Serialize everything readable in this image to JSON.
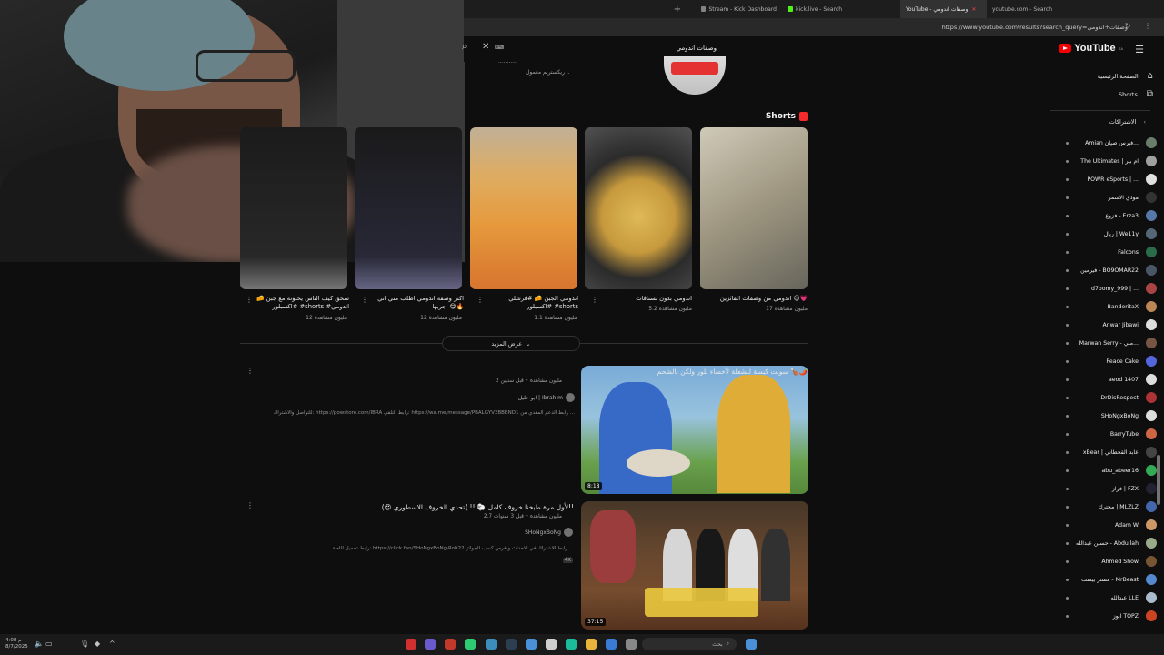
{
  "browser": {
    "tabs": [
      {
        "label": "Stream - Kick Dashboard",
        "color": "#888888",
        "active": false
      },
      {
        "label": "kick.live - Search",
        "color": "#53fc18",
        "active": false
      },
      {
        "label": "YouTube - وصفات اندومي",
        "color": "#ff0000",
        "active": true
      },
      {
        "label": "youtube.com - Search",
        "color": "#888888",
        "active": false
      }
    ],
    "url": "https://www.youtube.com/results?search_query=وصفات+اندومي",
    "add_tab": "+"
  },
  "youtube": {
    "logo_text": "YouTube",
    "logo_sup": "SA",
    "search_value": "وصفات اندومي",
    "top_lines": [
      "...........",
      "ريكستريم معمول .."
    ]
  },
  "shorts": {
    "heading": "Shorts",
    "items": [
      {
        "title": "اندومي من وصفات الفائزين 😍💗",
        "views": "17 مليون مشاهدة"
      },
      {
        "title": "اندومي بدون تستافات",
        "views": "5.2 مليون مشاهدة"
      },
      {
        "title": "اندومي الجبن 🧀 #فرشلي #اكسبلور #shorts",
        "views": "1.1 مليون مشاهدة"
      },
      {
        "title": "اكثر وصفة اندومي اطلب مني اني اجربها 😋🔥",
        "views": "12 مليون مشاهدة"
      },
      {
        "title": "سحق كيف الناس يحبونه مع جبن 🧀 #اكسبلور #shorts #اندومي",
        "views": "12 مليون مشاهدة"
      }
    ],
    "show_more": "عرض المزيد"
  },
  "videos": [
    {
      "title": "سويت كبسة للشعلة لأخصاء بلور ولكن بالشحم 🍗🌶️",
      "meta": "2 مليون مشاهدة • قبل سنتين",
      "channel": "ابو خليل | Ibrahim",
      "desc": "للتواصل والاشتراك: https://powstore.com/IBRA رابط التلقي: https://wa.me/message/PBALGYV3BBBND1 رابط الدعم المقدي من ...",
      "duration": "8:18"
    },
    {
      "title": "لأول مرة طبخنا خروف كامل 🐑 !! (تحدي الخروف الاسطوري 😍)!!",
      "meta": "2.7 مليون مشاهدة • قبل 3 سنوات",
      "channel": "SHoNgxBoNg",
      "desc": "رابط تحميل اللعبة: https://click.fan/SHoNgxBoNg-RoK22 رابط الاشتراك في الاحداث و فرص كسب الجوائز ...",
      "badge": "4K",
      "duration": "37:15"
    }
  ],
  "sidebar": {
    "main": [
      {
        "label": "الصفحة الرئيسية",
        "icon": "home-icon"
      },
      {
        "label": "Shorts",
        "icon": "shorts-icon"
      }
    ],
    "subs_title": "الاشتراكات",
    "subs": [
      {
        "name": "Amian فيرس صيان...",
        "color": "#6a7d6a"
      },
      {
        "name": "The Ultimates | ام بير",
        "color": "#a0a0a0"
      },
      {
        "name": "POWR eSports | ...",
        "color": "#e0e0e0"
      },
      {
        "name": "مودي الاسمر",
        "color": "#333333"
      },
      {
        "name": "فزوع - Erza3",
        "color": "#5577aa"
      },
      {
        "name": "ريال | We11y",
        "color": "#556677"
      },
      {
        "name": "Falcons",
        "color": "#2a6b4a"
      },
      {
        "name": "فيرمين - BO9OMAR22",
        "color": "#4a5566"
      },
      {
        "name": "d7oomy_999 | ...",
        "color": "#aa4444"
      },
      {
        "name": "BanderitaX",
        "color": "#bb8855"
      },
      {
        "name": "Anwar Jibawi",
        "color": "#dddddd"
      },
      {
        "name": "Marwan Serry - مبي...",
        "color": "#775544"
      },
      {
        "name": "Peace Cake",
        "color": "#5566dd"
      },
      {
        "name": "aeod 1407",
        "color": "#dddddd"
      },
      {
        "name": "DrDisRespect",
        "color": "#aa3333"
      },
      {
        "name": "SHoNgxBoNg",
        "color": "#dddddd"
      },
      {
        "name": "BarryTube",
        "color": "#cc6644"
      },
      {
        "name": "xBear | عابد القحطاني",
        "color": "#444444"
      },
      {
        "name": "abu_abeer16",
        "color": "#33aa55"
      },
      {
        "name": "فراز | FZX",
        "color": "#222233"
      },
      {
        "name": "مخترك | MLZLZ",
        "color": "#4466aa"
      },
      {
        "name": "Adam W",
        "color": "#cc9966"
      },
      {
        "name": "حسين عبدالله - Abdullah",
        "color": "#99aa88"
      },
      {
        "name": "Ahmed Show",
        "color": "#775533"
      },
      {
        "name": "مستر بيست - MrBeast",
        "color": "#5588cc"
      },
      {
        "name": "عبدالله LLE",
        "color": "#aabbcc"
      },
      {
        "name": "ابوز TOPZ",
        "color": "#cc4422"
      }
    ]
  },
  "taskbar": {
    "search_label": "بحث",
    "clock_time": "م 4:08",
    "clock_date": "8/7/2025"
  }
}
